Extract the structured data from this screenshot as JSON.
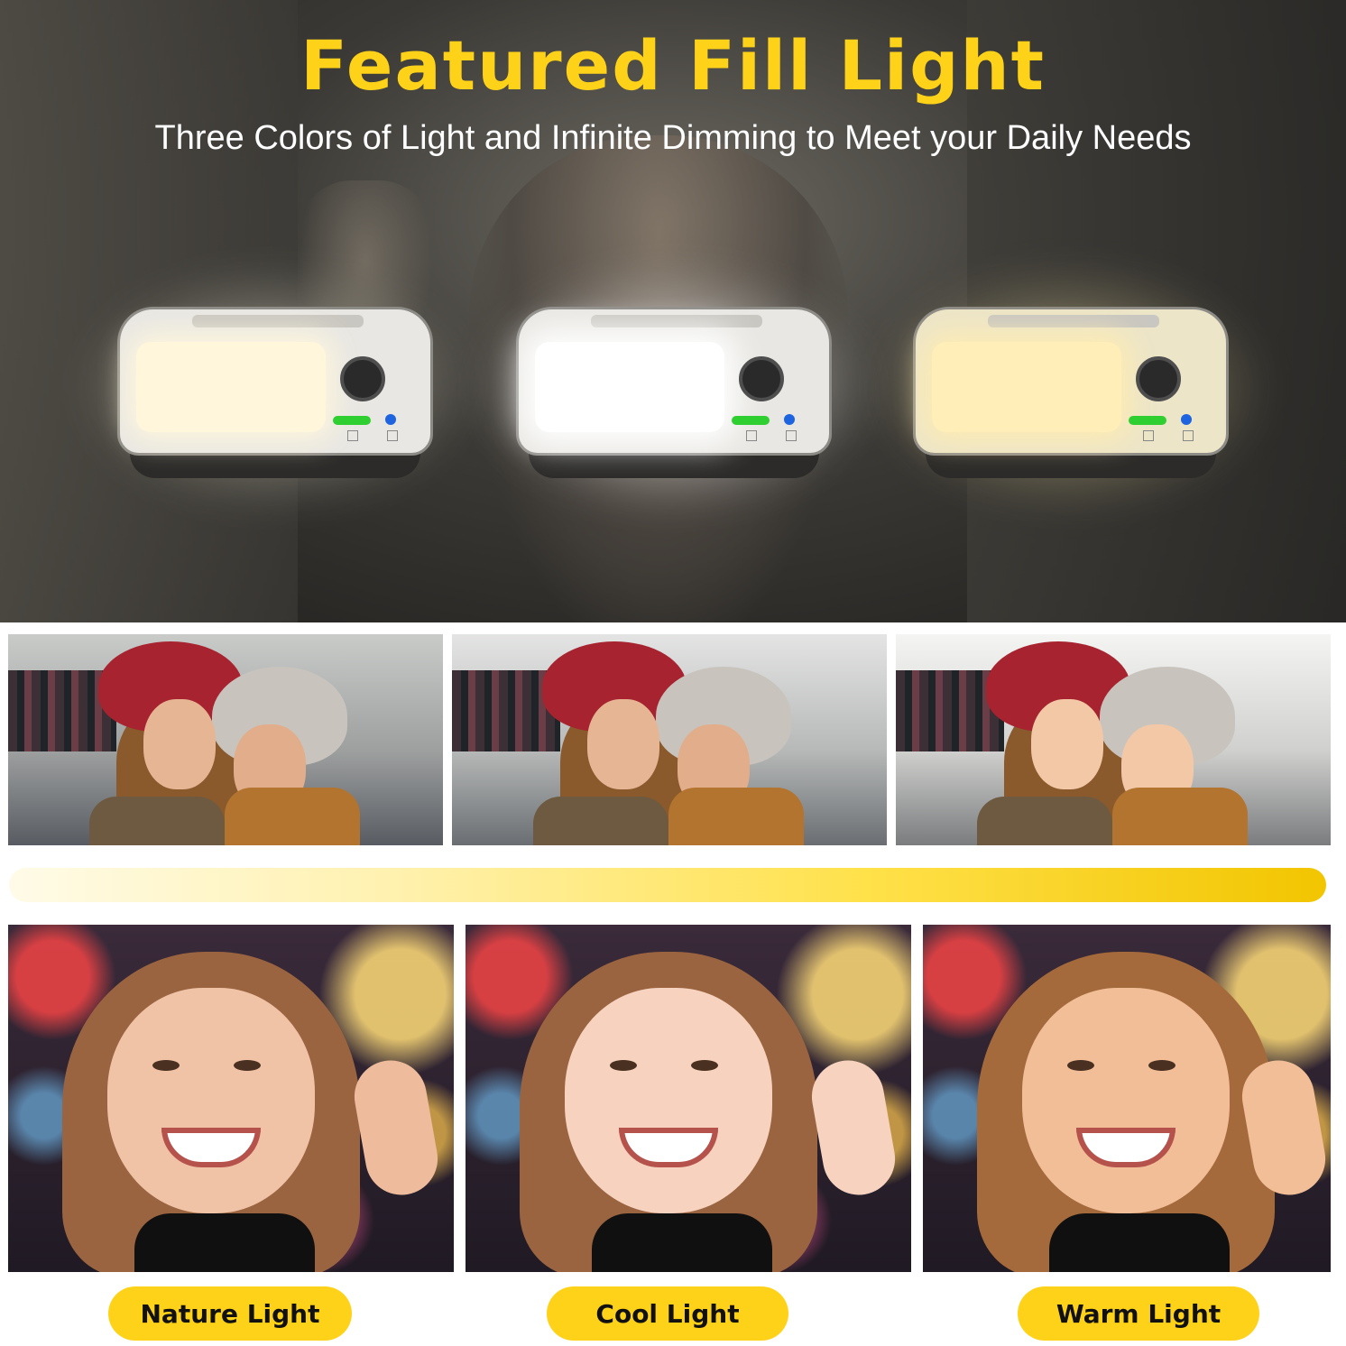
{
  "hero": {
    "title": "Featured Fill Light",
    "subtitle": "Three Colors of Light and Infinite Dimming to Meet your Daily Needs",
    "lamps": [
      {
        "mode": "natural",
        "panel_color": "#fff6dc"
      },
      {
        "mode": "cool",
        "panel_color": "#ffffff"
      },
      {
        "mode": "warm",
        "panel_color": "#ffeeb8"
      }
    ]
  },
  "gradient_bar": {
    "from_color": "#fffbe8",
    "to_color": "#f2c500"
  },
  "labels": {
    "nature": "Nature Light",
    "cool": "Cool Light",
    "warm": "Warm Light"
  },
  "colors": {
    "accent_yellow": "#ffd21a",
    "text_dark": "#111111",
    "text_light": "#ffffff"
  }
}
